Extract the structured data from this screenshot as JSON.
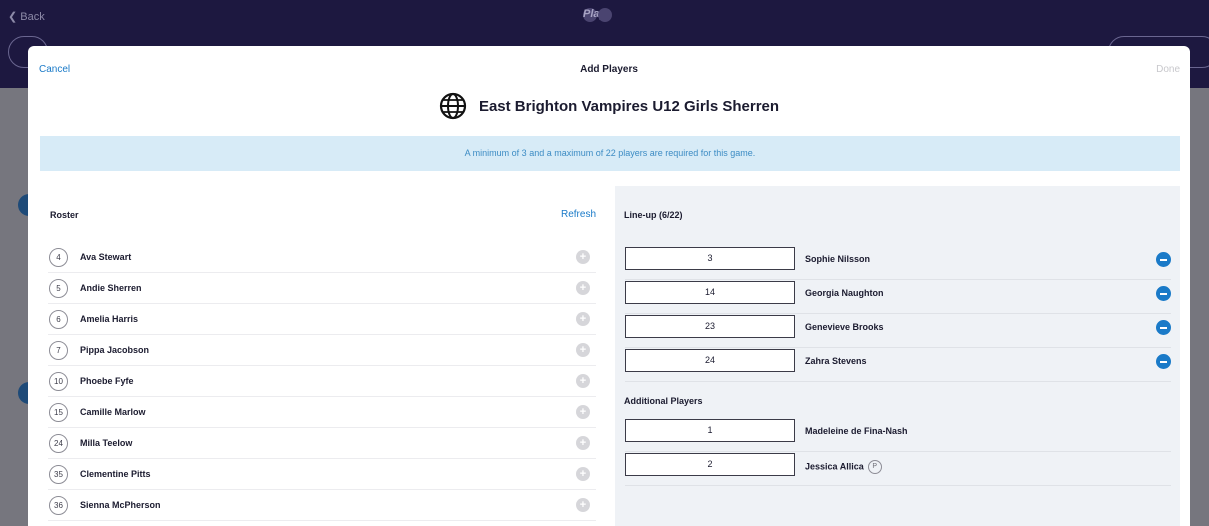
{
  "background": {
    "back_label": "Back",
    "logo_text": "Play"
  },
  "modal": {
    "cancel_label": "Cancel",
    "title": "Add Players",
    "done_label": "Done",
    "team_icon": "globe-icon",
    "team_name": "East Brighton Vampires U12 Girls Sherren",
    "notice": "A minimum of 3 and a maximum of 22 players are required for this game."
  },
  "roster": {
    "title": "Roster",
    "refresh_label": "Refresh",
    "players": [
      {
        "number": "4",
        "name": "Ava Stewart"
      },
      {
        "number": "5",
        "name": "Andie Sherren"
      },
      {
        "number": "6",
        "name": "Amelia Harris"
      },
      {
        "number": "7",
        "name": "Pippa Jacobson"
      },
      {
        "number": "10",
        "name": "Phoebe Fyfe"
      },
      {
        "number": "15",
        "name": "Camille Marlow"
      },
      {
        "number": "24",
        "name": "Milla Teelow"
      },
      {
        "number": "35",
        "name": "Clementine Pitts"
      },
      {
        "number": "36",
        "name": "Sienna McPherson"
      }
    ]
  },
  "lineup": {
    "title": "Line-up (6/22)",
    "players": [
      {
        "number": "3",
        "name": "Sophie Nilsson"
      },
      {
        "number": "14",
        "name": "Georgia Naughton"
      },
      {
        "number": "23",
        "name": "Genevieve Brooks"
      },
      {
        "number": "24",
        "name": "Zahra Stevens"
      }
    ],
    "additional_title": "Additional Players",
    "additional": [
      {
        "number": "1",
        "name": "Madeleine de Fina-Nash"
      },
      {
        "number": "2",
        "name": "Jessica Allica",
        "badge": "P"
      }
    ]
  },
  "colors": {
    "accent": "#1a7ac8",
    "notice_bg": "#d7ebf7",
    "notice_text": "#3d8cc4",
    "header_bg": "#1d1840"
  }
}
